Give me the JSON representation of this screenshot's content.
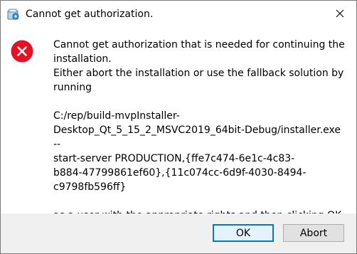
{
  "window": {
    "title": "Cannot get authorization.",
    "app_icon": "installer-icon",
    "close_icon": "close-icon"
  },
  "dialog": {
    "icon": "error-icon",
    "message_paragraph_1": "Cannot get authorization that is needed for continuing the installation.\n Either abort the installation or use the fallback solution by running",
    "message_paragraph_2": "C:/rep/build-mvpInstaller-\nDesktop_Qt_5_15_2_MSVC2019_64bit-Debug/installer.exe --\nstart-server PRODUCTION,{ffe7c474-6e1c-4c83-\nb884-47799861ef60},{11c074cc-6d9f-4030-8494-\nc9798fb596ff}",
    "message_paragraph_3": "as a user with the appropriate rights and then clicking OK."
  },
  "buttons": {
    "ok_label": "OK",
    "abort_label": "Abort"
  },
  "colors": {
    "error_red": "#e81123",
    "focus_blue": "#0078d7",
    "footer_bg": "#f0f0f0"
  }
}
